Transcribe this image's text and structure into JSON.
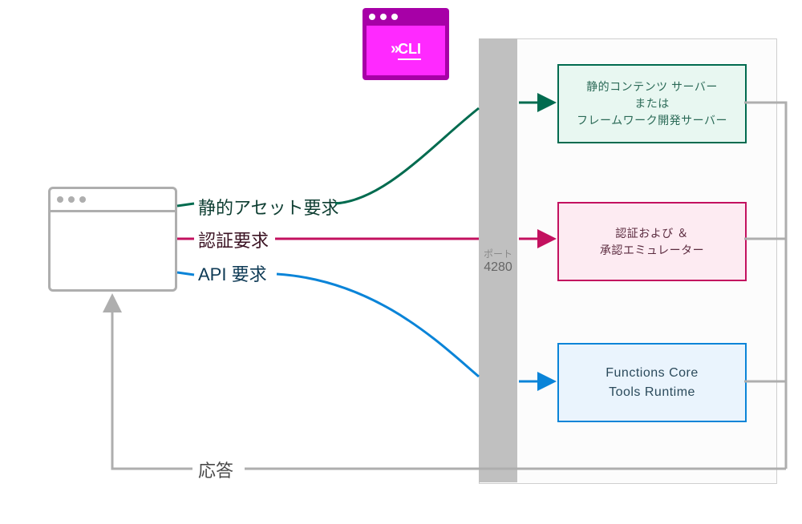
{
  "port": {
    "label": "ポート",
    "number": "4280"
  },
  "cli": {
    "caret": "»",
    "text": "CLI"
  },
  "labels": {
    "static_assets": "静的アセット要求",
    "auth_request": "認証要求",
    "api_request": "API 要求",
    "response": "応答"
  },
  "boxes": {
    "static": {
      "line1": "静的コンテンツ サーバー",
      "line2": "または",
      "line3": "フレームワーク開発サーバー"
    },
    "auth": {
      "line1": "認証および ＆",
      "line2": "承認エミュレーター"
    },
    "func": {
      "line1": "Functions Core",
      "line2": "Tools Runtime"
    }
  },
  "colors": {
    "static": "#006b4f",
    "auth": "#c3115f",
    "api": "#0a84d8",
    "gray": "#aeaeae"
  }
}
